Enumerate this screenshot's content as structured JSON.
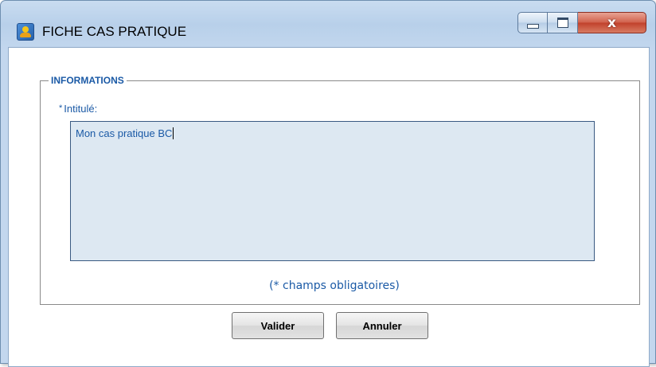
{
  "window": {
    "title": "FICHE CAS PRATIQUE",
    "icon": "app-user-icon",
    "controls": {
      "minimize_icon": "minimize-icon",
      "maximize_icon": "maximize-icon",
      "close_icon": "close-icon",
      "close_glyph": "x"
    }
  },
  "form": {
    "section_title": "INFORMATIONS",
    "field": {
      "required_mark": "*",
      "label": "Intitulé:",
      "value": "Mon cas pratique BC"
    },
    "required_note": "(* champs obligatoires)"
  },
  "buttons": {
    "submit_label": "Valider",
    "cancel_label": "Annuler"
  },
  "colors": {
    "accent_text": "#1b5aa6",
    "textarea_bg": "#dde8f2",
    "close_button": "#c1402b"
  }
}
